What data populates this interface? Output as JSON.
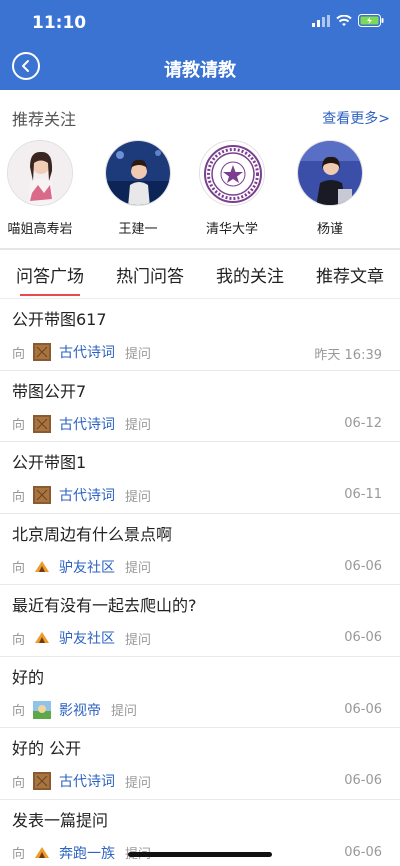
{
  "status": {
    "time": "11:10"
  },
  "header": {
    "title": "请教请教"
  },
  "recommend": {
    "heading": "推荐关注",
    "more": "查看更多>",
    "items": [
      {
        "name": "喵姐高寿岩"
      },
      {
        "name": "王建一"
      },
      {
        "name": "清华大学"
      },
      {
        "name": "杨谨"
      }
    ]
  },
  "tabs": [
    "问答广场",
    "热门问答",
    "我的关注",
    "推荐文章"
  ],
  "questions": [
    {
      "title": "公开带图617",
      "to": "向",
      "topic": "古代诗词",
      "ask": "提问",
      "time": "昨天 16:39",
      "thumb": "brown"
    },
    {
      "title": "带图公开7",
      "to": "向",
      "topic": "古代诗词",
      "ask": "提问",
      "time": "06-12",
      "thumb": "brown"
    },
    {
      "title": "公开带图1",
      "to": "向",
      "topic": "古代诗词",
      "ask": "提问",
      "time": "06-11",
      "thumb": "brown"
    },
    {
      "title": "北京周边有什么景点啊",
      "to": "向",
      "topic": "驴友社区",
      "ask": "提问",
      "time": "06-06",
      "thumb": "orange"
    },
    {
      "title": "最近有没有一起去爬山的?",
      "to": "向",
      "topic": "驴友社区",
      "ask": "提问",
      "time": "06-06",
      "thumb": "orange"
    },
    {
      "title": "好的",
      "to": "向",
      "topic": "影视帝",
      "ask": "提问",
      "time": "06-06",
      "thumb": "green"
    },
    {
      "title": "好的 公开",
      "to": "向",
      "topic": "古代诗词",
      "ask": "提问",
      "time": "06-06",
      "thumb": "brown"
    },
    {
      "title": "发表一篇提问",
      "to": "向",
      "topic": "奔跑一族",
      "ask": "提问",
      "time": "06-06",
      "thumb": "orange"
    }
  ],
  "colors": {
    "header": "#3a73d2",
    "link": "#2d63c2",
    "indicator": "#e94b4b"
  }
}
